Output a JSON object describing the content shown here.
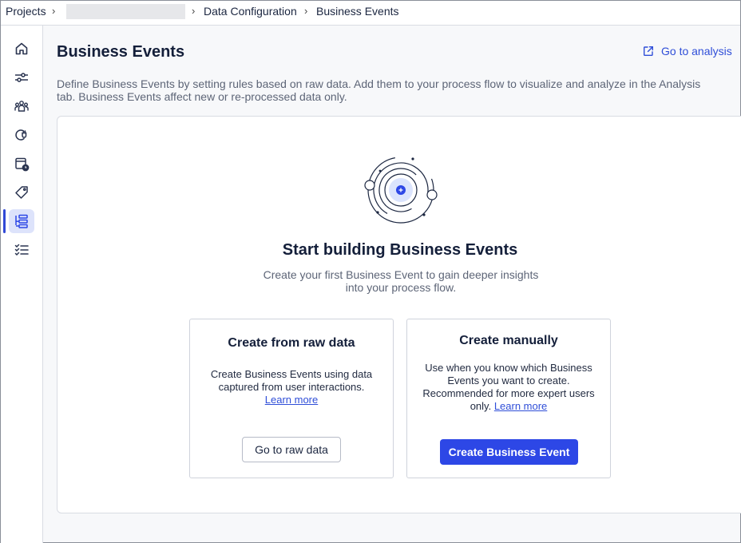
{
  "breadcrumb": {
    "projects": "Projects",
    "data_configuration": "Data Configuration",
    "current": "Business Events",
    "separator": "›"
  },
  "sidebar": {
    "items": [
      {
        "icon": "home-icon",
        "active": false
      },
      {
        "icon": "sliders-icon",
        "active": false
      },
      {
        "icon": "users-group-icon",
        "active": false
      },
      {
        "icon": "plug-icon",
        "active": false
      },
      {
        "icon": "calendar-clock-icon",
        "active": false
      },
      {
        "icon": "tag-icon",
        "active": false
      },
      {
        "icon": "business-events-icon",
        "active": true
      },
      {
        "icon": "checklist-icon",
        "active": false
      }
    ]
  },
  "header": {
    "title": "Business Events",
    "analysis_link": "Go to analysis",
    "description": "Define Business Events by setting rules based on raw data. Add them to your process flow to visualize and analyze in the Analysis tab. Business Events affect new or re-processed data only."
  },
  "empty_state": {
    "heading": "Start building Business Events",
    "subtext": "Create your first Business Event to gain deeper insights into your process flow."
  },
  "cards": {
    "raw": {
      "title": "Create from raw data",
      "text": "Create Business Events using data captured from user interactions.",
      "link": "Learn more",
      "button": "Go to raw data"
    },
    "manual": {
      "title": "Create manually",
      "text": "Use when you know which Business Events you want to create. Recommended for more expert users only.",
      "link": "Learn more",
      "button": "Create Business Event"
    }
  },
  "colors": {
    "accent": "#2d47e6",
    "link": "#2f4ed8",
    "active_nav_bg": "#dde3fb"
  }
}
